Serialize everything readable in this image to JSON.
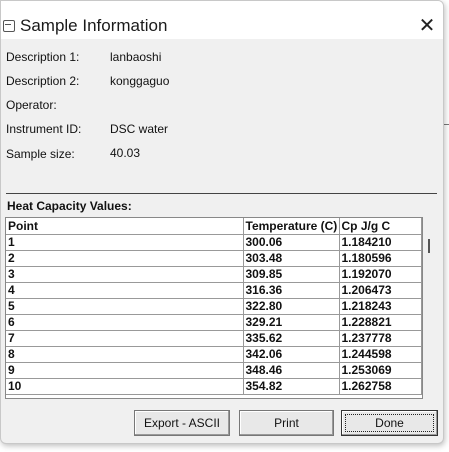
{
  "window": {
    "title": "Sample Information",
    "close_glyph": "✕"
  },
  "fields": [
    {
      "label": "Description 1:",
      "value": "lanbaoshi"
    },
    {
      "label": "Description 2:",
      "value": "konggaguo"
    },
    {
      "label": "Operator:",
      "value": ""
    },
    {
      "label": "Instrument ID:",
      "value": "DSC water"
    },
    {
      "label": "Sample size:",
      "value": "40.03"
    }
  ],
  "heat_capacity": {
    "section_title": "Heat Capacity Values:",
    "columns": [
      "Point",
      "Temperature (C)",
      "Cp J/g C"
    ],
    "rows": [
      [
        "1",
        "300.06",
        "1.184210"
      ],
      [
        "2",
        "303.48",
        "1.180596"
      ],
      [
        "3",
        "309.85",
        "1.192070"
      ],
      [
        "4",
        "316.36",
        "1.206473"
      ],
      [
        "5",
        "322.80",
        "1.218243"
      ],
      [
        "6",
        "329.21",
        "1.228821"
      ],
      [
        "7",
        "335.62",
        "1.237778"
      ],
      [
        "8",
        "342.06",
        "1.244598"
      ],
      [
        "9",
        "348.46",
        "1.253069"
      ],
      [
        "10",
        "354.82",
        "1.262758"
      ]
    ]
  },
  "buttons": {
    "export": "Export - ASCII",
    "print": "Print",
    "done": "Done"
  }
}
